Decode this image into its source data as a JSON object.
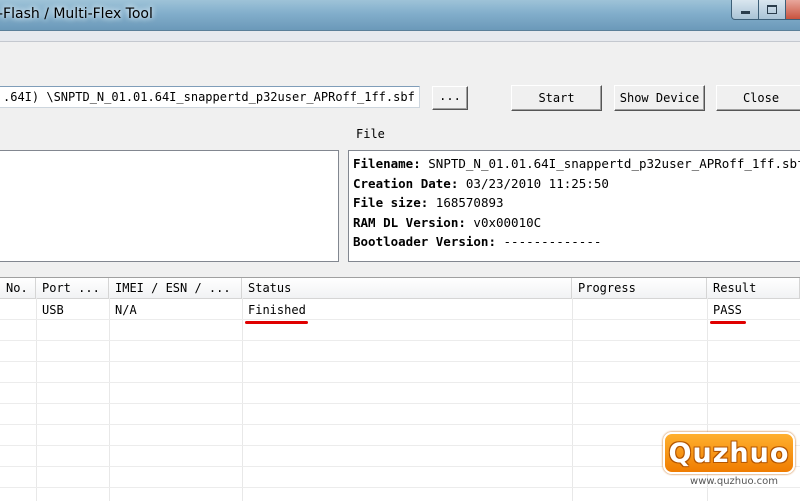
{
  "window": {
    "title": "-Flash / Multi-Flex Tool"
  },
  "toolbar": {
    "file_path": ".64I) \\SNPTD_N_01.01.64I_snappertd_p32user_APRoff_1ff.sbf",
    "browse_label": "...",
    "start_label": "Start",
    "show_device_label": "Show Device",
    "close_label": "Close"
  },
  "file_panel": {
    "label": "File",
    "lines": [
      {
        "key": "Filename:",
        "value": "SNPTD_N_01.01.64I_snappertd_p32user_APRoff_1ff.sbf"
      },
      {
        "key": "Creation Date:",
        "value": "03/23/2010 11:25:50"
      },
      {
        "key": "File size:",
        "value": "168570893"
      },
      {
        "key": "RAM DL Version:",
        "value": "v0x00010C"
      },
      {
        "key": "Bootloader Version:",
        "value": "-------------"
      }
    ]
  },
  "table": {
    "columns": [
      "No.",
      "Port ...",
      "IMEI / ESN / ...",
      "Status",
      "Progress",
      "Result"
    ],
    "rows": [
      {
        "no": "",
        "port": "USB",
        "imei": "N/A",
        "status": "Finished",
        "progress": "",
        "result": "PASS"
      }
    ]
  },
  "watermark": {
    "brand": "Quzhuo",
    "url": "www.quzhuo.com"
  },
  "colors": {
    "title_bar": "#82aecb",
    "annotation_underline": "#e00000",
    "watermark_orange": "#f07c00"
  }
}
